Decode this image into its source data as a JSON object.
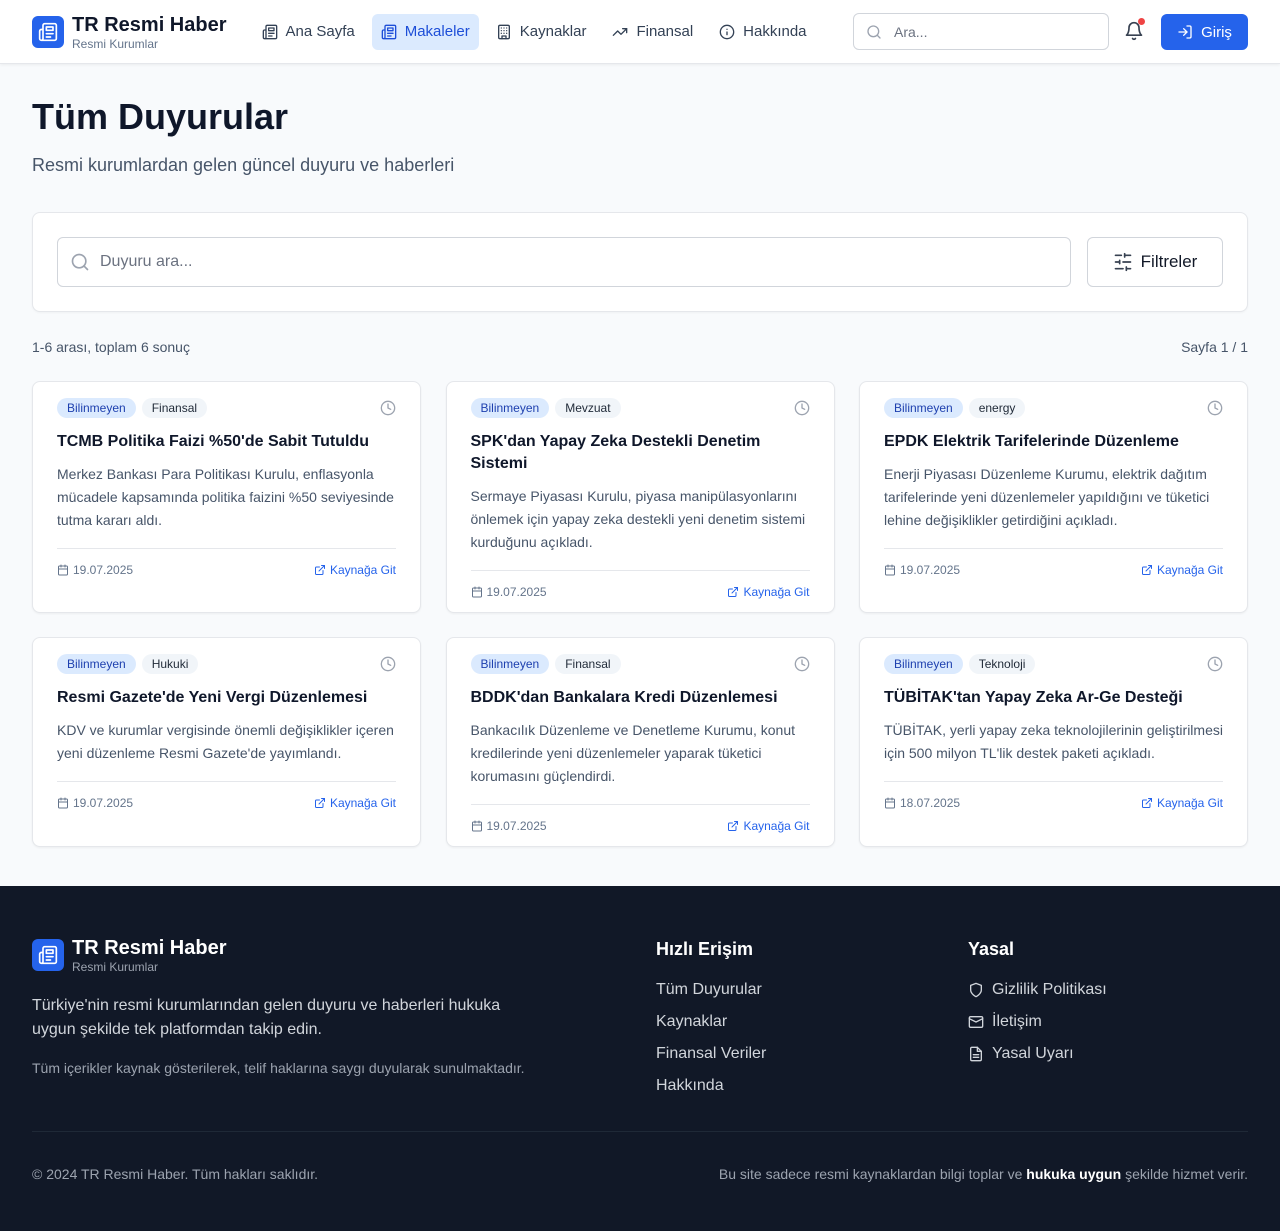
{
  "brand": {
    "title": "TR Resmi Haber",
    "subtitle": "Resmi Kurumlar"
  },
  "nav": [
    {
      "label": "Ana Sayfa",
      "icon": "newspaper-icon",
      "active": false
    },
    {
      "label": "Makaleler",
      "icon": "newspaper-icon",
      "active": true
    },
    {
      "label": "Kaynaklar",
      "icon": "building-icon",
      "active": false
    },
    {
      "label": "Finansal",
      "icon": "trending-up-icon",
      "active": false
    },
    {
      "label": "Hakkında",
      "icon": "info-icon",
      "active": false
    }
  ],
  "header": {
    "search_placeholder": "Ara...",
    "login_label": "Giriş",
    "notification_dot": true
  },
  "page": {
    "title": "Tüm Duyurular",
    "subtitle": "Resmi kurumlardan gelen güncel duyuru ve haberleri"
  },
  "search": {
    "placeholder": "Duyuru ara...",
    "filter_label": "Filtreler"
  },
  "results": {
    "summary": "1-6 arası, toplam 6 sonuç",
    "page": "Sayfa 1 / 1"
  },
  "articles": [
    {
      "status": "Bilinmeyen",
      "category": "Finansal",
      "title": "TCMB Politika Faizi %50'de Sabit Tutuldu",
      "desc": "Merkez Bankası Para Politikası Kurulu, enflasyonla mücadele kapsamında politika faizini %50 seviyesinde tutma kararı aldı.",
      "date": "19.07.2025",
      "link": "Kaynağa Git"
    },
    {
      "status": "Bilinmeyen",
      "category": "Mevzuat",
      "title": "SPK'dan Yapay Zeka Destekli Denetim Sistemi",
      "desc": "Sermaye Piyasası Kurulu, piyasa manipülasyonlarını önlemek için yapay zeka destekli yeni denetim sistemi kurduğunu açıkladı.",
      "date": "19.07.2025",
      "link": "Kaynağa Git"
    },
    {
      "status": "Bilinmeyen",
      "category": "energy",
      "title": "EPDK Elektrik Tarifelerinde Düzenleme",
      "desc": "Enerji Piyasası Düzenleme Kurumu, elektrik dağıtım tarifelerinde yeni düzenlemeler yapıldığını ve tüketici lehine değişiklikler getirdiğini açıkladı.",
      "date": "19.07.2025",
      "link": "Kaynağa Git"
    },
    {
      "status": "Bilinmeyen",
      "category": "Hukuki",
      "title": "Resmi Gazete'de Yeni Vergi Düzenlemesi",
      "desc": "KDV ve kurumlar vergisinde önemli değişiklikler içeren yeni düzenleme Resmi Gazete'de yayımlandı.",
      "date": "19.07.2025",
      "link": "Kaynağa Git"
    },
    {
      "status": "Bilinmeyen",
      "category": "Finansal",
      "title": "BDDK'dan Bankalara Kredi Düzenlemesi",
      "desc": "Bankacılık Düzenleme ve Denetleme Kurumu, konut kredilerinde yeni düzenlemeler yaparak tüketici korumasını güçlendirdi.",
      "date": "19.07.2025",
      "link": "Kaynağa Git"
    },
    {
      "status": "Bilinmeyen",
      "category": "Teknoloji",
      "title": "TÜBİTAK'tan Yapay Zeka Ar-Ge Desteği",
      "desc": "TÜBİTAK, yerli yapay zeka teknolojilerinin geliştirilmesi için 500 milyon TL'lik destek paketi açıkladı.",
      "date": "18.07.2025",
      "link": "Kaynağa Git"
    }
  ],
  "footer": {
    "description": "Türkiye'nin resmi kurumlarından gelen duyuru ve haberleri hukuka uygun şekilde tek platformdan takip edin.",
    "note": "Tüm içerikler kaynak gösterilerek, telif haklarına saygı duyularak sunulmaktadır.",
    "quick_title": "Hızlı Erişim",
    "quick_links": [
      "Tüm Duyurular",
      "Kaynaklar",
      "Finansal Veriler",
      "Hakkında"
    ],
    "legal_title": "Yasal",
    "legal_links": [
      {
        "label": "Gizlilik Politikası",
        "icon": "shield-icon"
      },
      {
        "label": "İletişim",
        "icon": "mail-icon"
      },
      {
        "label": "Yasal Uyarı",
        "icon": "file-text-icon"
      }
    ],
    "copyright": "© 2024 TR Resmi Haber. Tüm hakları saklıdır.",
    "bottom_pre": "Bu site sadece resmi kaynaklardan bilgi toplar ve",
    "bottom_bold": "hukuka uygun",
    "bottom_post": "şekilde hizmet verir."
  },
  "colors": {
    "accent": "#2563eb",
    "active_nav_bg": "#dbeafe",
    "footer_bg": "#111827",
    "notification": "#ef4444"
  }
}
